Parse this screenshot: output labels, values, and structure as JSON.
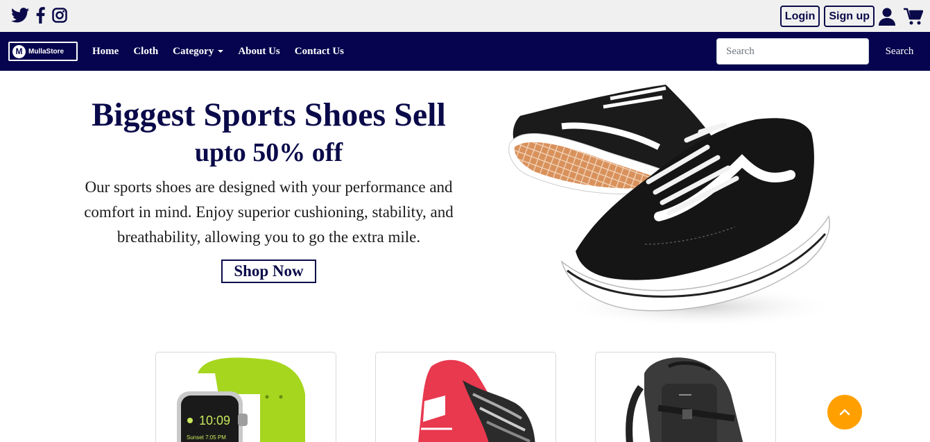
{
  "topbar": {
    "social": [
      "twitter-icon",
      "facebook-icon",
      "instagram-icon"
    ],
    "login_label": "Login",
    "signup_label": "Sign up"
  },
  "navbar": {
    "logo_text": "MullaStore",
    "logo_letter": "M",
    "links": [
      "Home",
      "Cloth",
      "Category",
      "About Us",
      "Contact Us"
    ],
    "search_placeholder": "Search",
    "search_button": "Search"
  },
  "hero": {
    "title": "Biggest Sports Shoes Sell",
    "subtitle": "upto 50% off",
    "description": "Our sports shoes are designed with your performance and comfort in mind. Enjoy superior cushioning, stability, and breathability, allowing you to go the extra mile.",
    "cta": "Shop Now"
  },
  "products": {
    "watch_time": "10:09",
    "watch_subtext": "Sunset 7:05 PM"
  },
  "colors": {
    "navy": "#06044e",
    "accent": "#ffa000",
    "topbar": "#f0f0f0"
  }
}
